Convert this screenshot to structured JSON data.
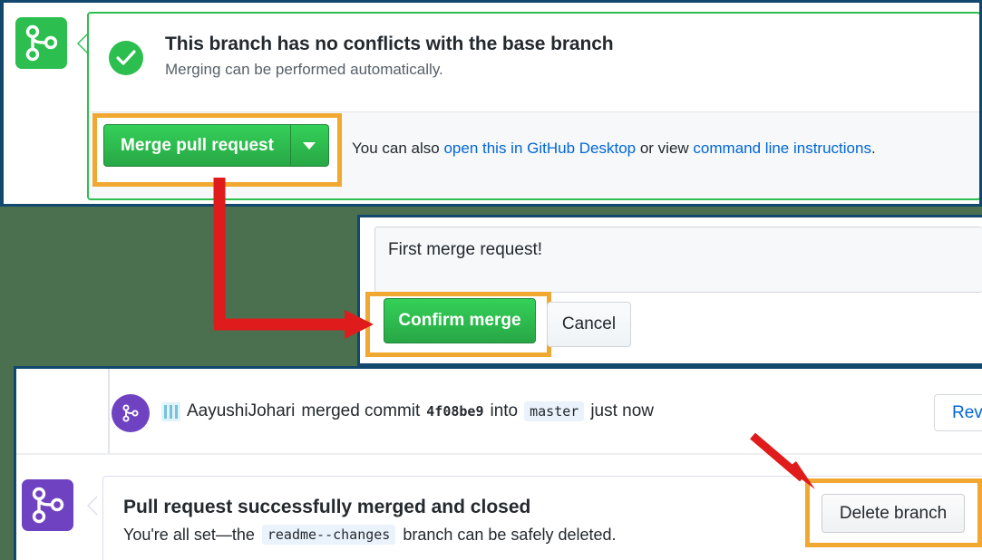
{
  "theme": {
    "background": "#4a7050",
    "panel_border": "#12486e",
    "annotation_highlight": "#f0a830",
    "annotation_arrow": "#e01b1b",
    "success_green": "#2cbe4e",
    "merged_purple": "#6f42c1",
    "link_blue": "#0366d6"
  },
  "top_panel": {
    "merge_icon_name": "git-merge-icon",
    "status_icon_name": "check-circle-icon",
    "title": "This branch has no conflicts with the base branch",
    "subtitle": "Merging can be performed automatically.",
    "merge_button_label": "Merge pull request",
    "merge_dropdown_icon": "chevron-down-icon",
    "note_prefix": "You can also ",
    "note_link1": "open this in GitHub Desktop",
    "note_middle": " or view ",
    "note_link2": "command line instructions",
    "note_suffix": "."
  },
  "middle_panel": {
    "commit_title_value": "First merge request!",
    "confirm_button_label": "Confirm merge",
    "cancel_button_label": "Cancel"
  },
  "bottom_panel": {
    "merge_circle_icon": "git-merge-icon",
    "avatar_icon": "avatar-icon",
    "author": "AayushiJohari",
    "action_text": "merged commit",
    "commit_sha": "4f08be9",
    "into_text": "into",
    "base_branch": "master",
    "timestamp": "just now",
    "revert_button_label": "Revert",
    "result_icon_name": "git-merge-icon",
    "result_title": "Pull request successfully merged and closed",
    "result_sub_prefix": "You're all set—the",
    "result_branch": "readme--changes",
    "result_sub_suffix": "branch can be safely deleted.",
    "delete_button_label": "Delete branch"
  },
  "annotations": {
    "highlight_merge_button": "highlight-merge-pull-request",
    "highlight_confirm_button": "highlight-confirm-merge",
    "highlight_delete_button": "highlight-delete-branch",
    "arrow_merge_to_confirm": "arrow-merge-to-confirm",
    "arrow_to_delete": "arrow-to-delete-branch"
  }
}
